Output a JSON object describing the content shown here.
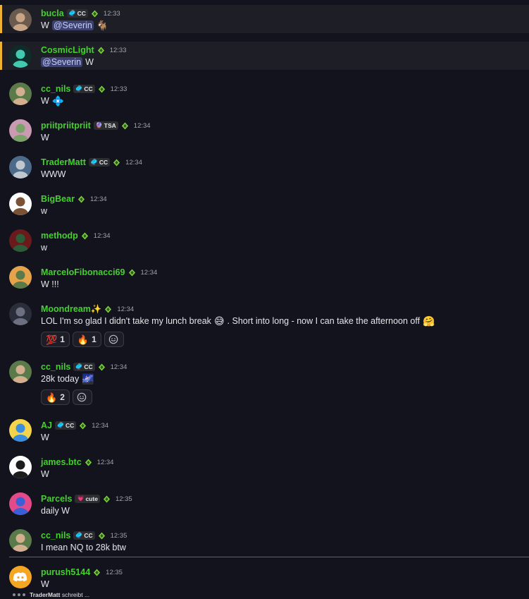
{
  "messages": [
    {
      "user": "bucla",
      "tag": {
        "icon": "🥏",
        "text": "CC"
      },
      "time": "12:33",
      "parts": [
        {
          "t": "W"
        },
        {
          "mention": "@Severin"
        },
        {
          "emoji": "🐐"
        }
      ],
      "mentioned": true
    },
    {
      "user": "CosmicLight",
      "tag": null,
      "time": "12:33",
      "parts": [
        {
          "mention": "@Severin"
        },
        {
          "t": "W"
        }
      ],
      "mentioned": true
    },
    {
      "user": "cc_nils",
      "tag": {
        "icon": "🥏",
        "text": "CC"
      },
      "time": "12:33",
      "parts": [
        {
          "t": "W"
        },
        {
          "emoji": "💠"
        }
      ]
    },
    {
      "user": "priitpriitpriit",
      "tag": {
        "icon": "🔮",
        "text": "TSA"
      },
      "time": "12:34",
      "parts": [
        {
          "t": "W"
        }
      ]
    },
    {
      "user": "TraderMatt",
      "tag": {
        "icon": "🥏",
        "text": "CC"
      },
      "time": "12:34",
      "parts": [
        {
          "t": "WWW"
        }
      ]
    },
    {
      "user": "BigBear",
      "tag": null,
      "time": "12:34",
      "parts": [
        {
          "t": "w"
        }
      ]
    },
    {
      "user": "methodp",
      "tag": null,
      "time": "12:34",
      "parts": [
        {
          "t": "w"
        }
      ]
    },
    {
      "user": "MarceloFibonacci69",
      "tag": null,
      "time": "12:34",
      "parts": [
        {
          "t": "W !!!"
        }
      ]
    },
    {
      "user": "Moondream✨",
      "tag": null,
      "time": "12:34",
      "parts": [
        {
          "t": "LOL I'm so glad I didn't take my lunch break"
        },
        {
          "emoji": "😅"
        },
        {
          "t": ". Short into long - now I can take the afternoon off"
        },
        {
          "emoji": "🤗"
        }
      ],
      "reactions": [
        {
          "emoji": "💯",
          "count": "1"
        },
        {
          "emoji": "🔥",
          "count": "1"
        }
      ]
    },
    {
      "user": "cc_nils",
      "tag": {
        "icon": "🥏",
        "text": "CC"
      },
      "time": "12:34",
      "parts": [
        {
          "t": "28k today"
        },
        {
          "emoji": "🌌"
        }
      ],
      "reactions": [
        {
          "emoji": "🔥",
          "count": "2"
        }
      ]
    },
    {
      "user": "AJ",
      "tag": {
        "icon": "🥏",
        "text": "CC"
      },
      "time": "12:34",
      "parts": [
        {
          "t": "W"
        }
      ]
    },
    {
      "user": "james.btc",
      "tag": null,
      "time": "12:34",
      "parts": [
        {
          "t": "W"
        }
      ]
    },
    {
      "user": "Parcels",
      "tag": {
        "icon": "💗",
        "text": "cute"
      },
      "time": "12:35",
      "parts": [
        {
          "t": "daily W"
        }
      ]
    },
    {
      "user": "cc_nils",
      "tag": {
        "icon": "🥏",
        "text": "CC"
      },
      "time": "12:35",
      "parts": [
        {
          "t": "I mean NQ to 28k btw"
        }
      ]
    },
    {
      "user": "purush5144",
      "tag": null,
      "time": "12:35",
      "parts": [
        {
          "t": "W"
        }
      ]
    }
  ],
  "typing": {
    "user": "TraderMatt",
    "suffix": "schreibt ..."
  },
  "colors": {
    "username": "#43d12e",
    "mention_bar": "#f0b232",
    "new_divider": "#c23b3b",
    "mention_pill": "#3c4270"
  }
}
